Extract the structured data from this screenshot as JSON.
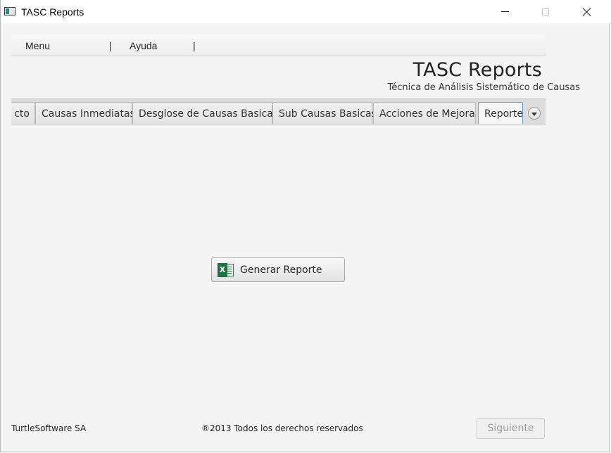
{
  "window": {
    "title": "TASC Reports"
  },
  "menubar": {
    "items": [
      "Menu",
      "Ayuda"
    ],
    "separator": "|"
  },
  "header": {
    "title": "TASC Reports",
    "subtitle": "Técnica de Análisis Sistemático de Causas"
  },
  "tabs": {
    "items": [
      {
        "label": "cto"
      },
      {
        "label": "Causas Inmediatas"
      },
      {
        "label": "Desglose de Causas Basicas"
      },
      {
        "label": "Sub Causas Basicas"
      },
      {
        "label": "Acciones de Mejora"
      },
      {
        "label": "Reporte",
        "active": true
      }
    ],
    "overflow_icon": "chevron-down-icon"
  },
  "main": {
    "generate_button": {
      "label": "Generar Reporte",
      "icon": "excel-icon"
    }
  },
  "footer": {
    "company": "TurtleSoftware SA",
    "copyright": "®2013 Todos los derechos reservados",
    "next_button": "Siguiente"
  },
  "colors": {
    "active_tab_border": "#5fa3d9",
    "excel_green": "#1e7145",
    "disabled_text": "#9c9c9c"
  }
}
